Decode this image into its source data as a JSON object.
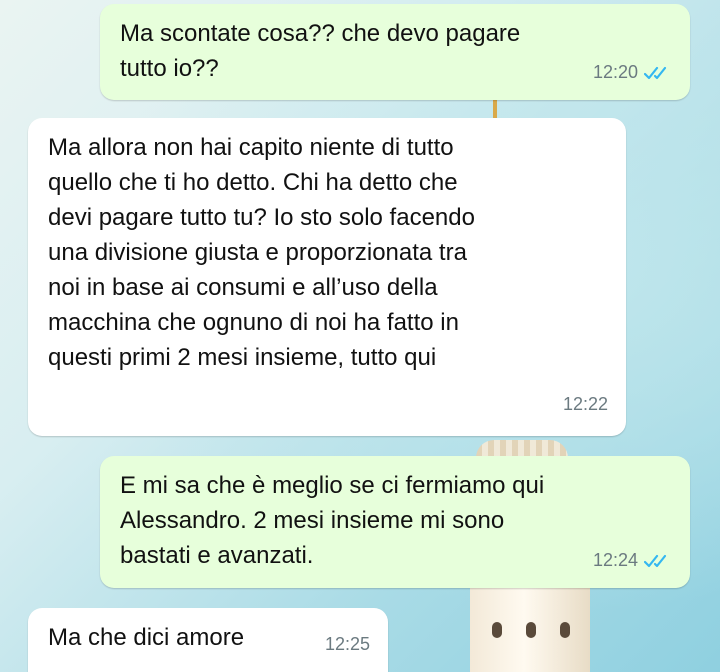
{
  "messages": [
    {
      "direction": "outgoing",
      "text": "Ma scontate cosa?? che devo pagare\ntutto io??",
      "time": "12:20",
      "status": "read"
    },
    {
      "direction": "incoming",
      "text": "Ma allora non hai capito niente di tutto\nquello che ti ho detto. Chi ha detto che\ndevi pagare tutto tu? Io sto solo facendo\nuna divisione giusta e proporzionata tra\nnoi in base ai consumi e all’uso della\nmacchina che ognuno di noi ha fatto in\nquesti primi 2 mesi insieme, tutto qui",
      "time": "12:22"
    },
    {
      "direction": "outgoing",
      "text": "E mi sa che è meglio se ci fermiamo qui\nAlessandro. 2 mesi insieme mi sono\nbastati e avanzati.",
      "time": "12:24",
      "status": "read"
    },
    {
      "direction": "incoming",
      "text": "Ma che dici amore",
      "time": "12:25"
    }
  ],
  "colors": {
    "outgoing_bubble": "#e7ffdb",
    "incoming_bubble": "#ffffff",
    "read_ticks": "#34b7f1",
    "timestamp": "#6b7a80"
  },
  "icons": {
    "read_receipt": "double-check-icon"
  }
}
